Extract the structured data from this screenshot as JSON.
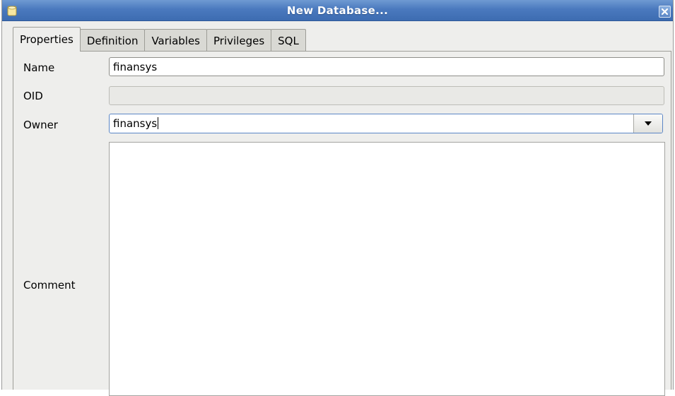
{
  "window": {
    "title": "New Database...",
    "icon": "database-icon",
    "close_icon": "close-icon",
    "title_color": "#4a79be"
  },
  "tabs": [
    {
      "label": "Properties",
      "active": true
    },
    {
      "label": "Definition",
      "active": false
    },
    {
      "label": "Variables",
      "active": false
    },
    {
      "label": "Privileges",
      "active": false
    },
    {
      "label": "SQL",
      "active": false
    }
  ],
  "form": {
    "name": {
      "label": "Name",
      "value": "finansys"
    },
    "oid": {
      "label": "OID",
      "value": ""
    },
    "owner": {
      "label": "Owner",
      "value": "finansys",
      "dropdown_icon": "chevron-down-icon"
    },
    "comment": {
      "label": "Comment",
      "value": ""
    }
  }
}
